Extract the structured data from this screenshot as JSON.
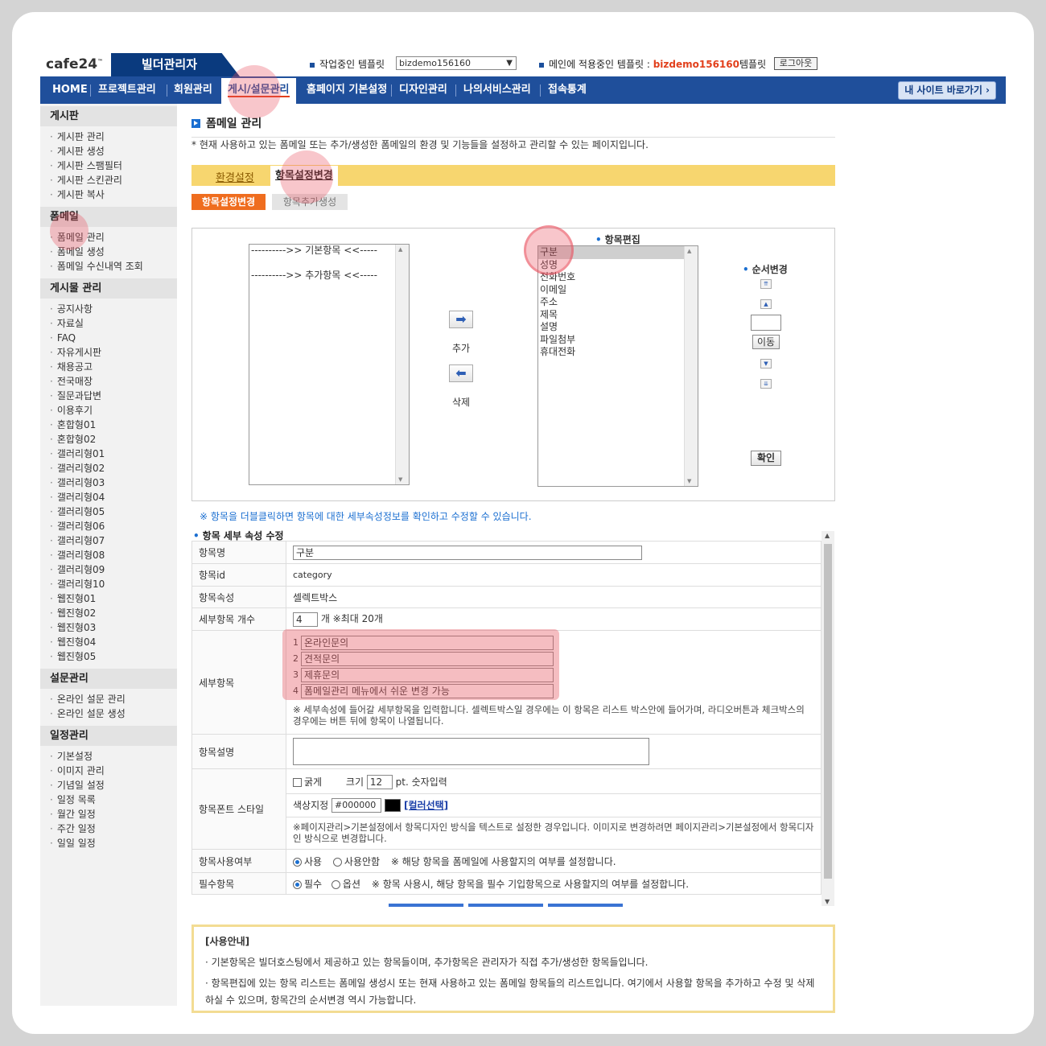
{
  "header": {
    "logo": "cafe24",
    "logo_tm": "™",
    "builder_tab": "빌더관리자",
    "working_template_label": "작업중인 템플릿",
    "working_template_value": "bizdemo156160",
    "applied_template_label": "메인에 적용중인 템플릿 :",
    "applied_template_name": "bizdemo156160",
    "applied_template_suffix": "템플릿",
    "logout": "로그아웃"
  },
  "nav": {
    "items": [
      "HOME",
      "프로젝트관리",
      "회원관리",
      "게시/설문관리",
      "홈페이지 기본설정",
      "디자인관리",
      "나의서비스관리",
      "접속통계"
    ],
    "my_site": "내 사이트 바로가기 ›"
  },
  "sidebar": {
    "sections": [
      {
        "title": "게시판",
        "items": [
          "게시판 관리",
          "게시판 생성",
          "게시판 스팸필터",
          "게시판 스킨관리",
          "게시판 복사"
        ]
      },
      {
        "title": "폼메일",
        "items": [
          "폼메일 관리",
          "폼메일 생성",
          "폼메일 수신내역 조회"
        ]
      },
      {
        "title": "게시물 관리",
        "items": [
          "공지사항",
          "자료실",
          "FAQ",
          "자유게시판",
          "채용공고",
          "전국매장",
          "질문과답변",
          "이용후기",
          "혼합형01",
          "혼합형02",
          "갤러리형01",
          "갤러리형02",
          "갤러리형03",
          "갤러리형04",
          "갤러리형05",
          "갤러리형06",
          "갤러리형07",
          "갤러리형08",
          "갤러리형09",
          "갤러리형10",
          "웹진형01",
          "웹진형02",
          "웹진형03",
          "웹진형04",
          "웹진형05"
        ]
      },
      {
        "title": "설문관리",
        "items": [
          "온라인 설문 관리",
          "온라인 설문 생성"
        ]
      },
      {
        "title": "일정관리",
        "items": [
          "기본설정",
          "이미지 관리",
          "기념일 설정",
          "일정 목록",
          "월간 일정",
          "주간 일정",
          "일일 일정"
        ]
      }
    ]
  },
  "page": {
    "title": "폼메일 관리",
    "description": "* 현재 사용하고 있는 폼메일 또는 추가/생성한 폼메일의 환경 및 기능들을 설정하고 관리할 수 있는 페이지입니다.",
    "tabs": [
      "환경설정",
      "항목설정변경"
    ],
    "subtabs": [
      "항목설정변경",
      "항목추가생성"
    ]
  },
  "editor": {
    "source_list": [
      "---------->> 기본항목 <<-----",
      "",
      "---------->> 추가항목 <<-----"
    ],
    "add_label": "추가",
    "delete_label": "삭제",
    "target_title": "항목편집",
    "target_list": [
      "구분",
      "성명",
      "전화번호",
      "이메일",
      "주소",
      "제목",
      "설명",
      "파일첨부",
      "휴대전화"
    ],
    "order_title": "순서변경",
    "move_label": "이동",
    "confirm_label": "확인",
    "note": "※ 항목을 더블클릭하면 항목에 대한 세부속성정보를 확인하고 수정할 수 있습니다."
  },
  "detail": {
    "section_title": "항목 세부 속성 수정",
    "rows": {
      "name_label": "항목명",
      "name_value": "구분",
      "id_label": "항목id",
      "id_value": "category",
      "attr_label": "항목속성",
      "attr_value": "셀렉트박스",
      "count_label": "세부항목 개수",
      "count_value": "4",
      "count_suffix": "개 ※최대 20개",
      "sub_label": "세부항목",
      "sub_items": [
        "온라인문의",
        "견적문의",
        "제휴문의",
        "폼메일관리 메뉴에서 쉬운 변경 가능"
      ],
      "sub_note": "※ 세부속성에 들어갈 세부항목을 입력합니다. 셀렉트박스일 경우에는 이 항목은 리스트 박스안에 들어가며, 라디오버튼과 체크박스의 경우에는 버튼 뒤에 항목이 나열됩니다.",
      "desc_label": "항목설명",
      "font_label": "항목폰트 스타일",
      "bold_label": "굵게",
      "size_label": "크기",
      "size_value": "12",
      "size_suffix": "pt. 숫자입력",
      "color_label": "색상지정",
      "color_value": "#000000",
      "color_pick": "[컬러선택]",
      "font_note": "※페이지관리>기본설정에서 항목디자인 방식을 텍스트로 설정한 경우입니다. 이미지로 변경하려면 페이지관리>기본설정에서 항목디자인 방식으로 변경합니다.",
      "use_label": "항목사용여부",
      "use_on": "사용",
      "use_off": "사용안함",
      "use_note": "※ 해당 항목을 폼메일에 사용할지의 여부를 설정합니다.",
      "req_label": "필수항목",
      "req_on": "필수",
      "req_off": "옵션",
      "req_note": "※ 항목 사용시, 해당 항목을 필수 기입항목으로 사용할지의 여부를 설정합니다."
    }
  },
  "guide": {
    "title": "[사용안내]",
    "lines": [
      "· 기본항목은 빌더호스팅에서 제공하고 있는 항목들이며, 추가항목은 관리자가 직접 추가/생성한 항목들입니다.",
      "· 항목편집에 있는 항목 리스트는 폼메일 생성시 또는 현재 사용하고 있는 폼메일 항목들의 리스트입니다. 여기에서 사용할 항목을 추가하고 수정 및 삭제하실 수 있으며, 항목간의 순서변경 역시 가능합니다."
    ]
  },
  "colors": {
    "nav": "#1f4f9b",
    "accent_orange": "#ef6d1f",
    "tab_yellow": "#f7d66f",
    "highlight": "#e84e5c"
  }
}
